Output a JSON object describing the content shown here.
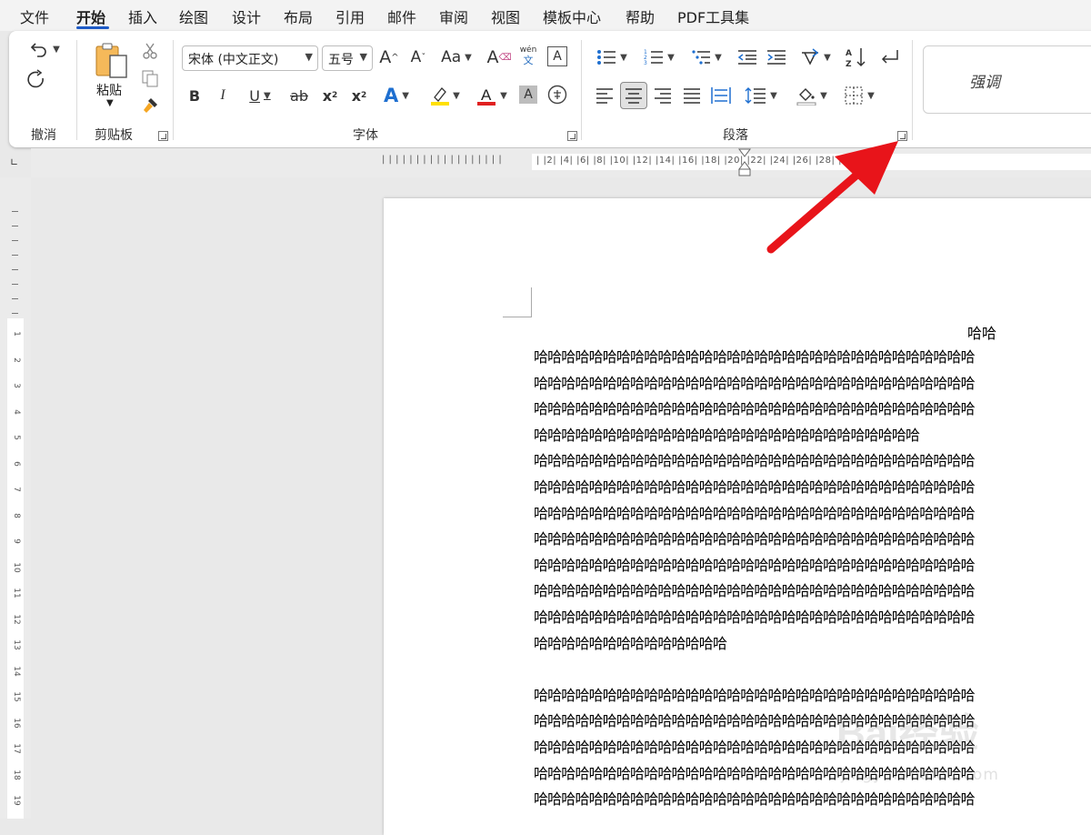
{
  "menu": {
    "items": [
      "文件",
      "开始",
      "插入",
      "绘图",
      "设计",
      "布局",
      "引用",
      "邮件",
      "审阅",
      "视图",
      "模板中心",
      "帮助",
      "PDF工具集"
    ],
    "active": "开始"
  },
  "ribbon": {
    "undo_group": {
      "label": "撤消",
      "undo_icon": "undo-icon",
      "redo_icon": "redo-icon"
    },
    "clipboard_group": {
      "label": "剪贴板",
      "paste_label": "粘贴"
    },
    "font_group": {
      "label": "字体",
      "font_name": "宋体 (中文正文)",
      "font_size": "五号",
      "change_case_label": "Aa",
      "phonetic_top": "wén",
      "phonetic_bottom": "文"
    },
    "paragraph_group": {
      "label": "段落"
    },
    "styles": {
      "preview": "强调"
    }
  },
  "ruler": {
    "h_left_ticks": "| | | | | | | | | | | | | | | | | |",
    "h_numbers": "|  |2|  |4|  |6|  |8|  |10|  |12|  |14|  |16|  |18|  |20|  |22|  |24|  |26|  |28|  |30|",
    "v_numbers": [
      "1",
      "2",
      "3",
      "4",
      "5",
      "6",
      "7",
      "8",
      "9",
      "10",
      "11",
      "12",
      "13",
      "14",
      "15",
      "16",
      "17",
      "18",
      "19"
    ],
    "tab_selector": "∟"
  },
  "document": {
    "title": "哈哈",
    "lines": [
      "哈哈哈哈哈哈哈哈哈哈哈哈哈哈哈哈哈哈哈哈哈哈哈哈哈哈哈哈哈哈哈哈",
      "哈哈哈哈哈哈哈哈哈哈哈哈哈哈哈哈哈哈哈哈哈哈哈哈哈哈哈哈哈哈哈哈",
      "哈哈哈哈哈哈哈哈哈哈哈哈哈哈哈哈哈哈哈哈哈哈哈哈哈哈哈哈哈哈哈哈",
      "哈哈哈哈哈哈哈哈哈哈哈哈哈哈哈哈哈哈哈哈哈哈哈哈哈哈哈哈",
      "哈哈哈哈哈哈哈哈哈哈哈哈哈哈哈哈哈哈哈哈哈哈哈哈哈哈哈哈哈哈哈哈",
      "哈哈哈哈哈哈哈哈哈哈哈哈哈哈哈哈哈哈哈哈哈哈哈哈哈哈哈哈哈哈哈哈",
      "哈哈哈哈哈哈哈哈哈哈哈哈哈哈哈哈哈哈哈哈哈哈哈哈哈哈哈哈哈哈哈哈",
      "哈哈哈哈哈哈哈哈哈哈哈哈哈哈哈哈哈哈哈哈哈哈哈哈哈哈哈哈哈哈哈哈",
      "哈哈哈哈哈哈哈哈哈哈哈哈哈哈哈哈哈哈哈哈哈哈哈哈哈哈哈哈哈哈哈哈",
      "哈哈哈哈哈哈哈哈哈哈哈哈哈哈哈哈哈哈哈哈哈哈哈哈哈哈哈哈哈哈哈哈",
      "哈哈哈哈哈哈哈哈哈哈哈哈哈哈哈哈哈哈哈哈哈哈哈哈哈哈哈哈哈哈哈哈",
      "哈哈哈哈哈哈哈哈哈哈哈哈哈哈",
      "",
      "哈哈哈哈哈哈哈哈哈哈哈哈哈哈哈哈哈哈哈哈哈哈哈哈哈哈哈哈哈哈哈哈",
      "哈哈哈哈哈哈哈哈哈哈哈哈哈哈哈哈哈哈哈哈哈哈哈哈哈哈哈哈哈哈哈哈",
      "哈哈哈哈哈哈哈哈哈哈哈哈哈哈哈哈哈哈哈哈哈哈哈哈哈哈哈哈哈哈哈哈",
      "哈哈哈哈哈哈哈哈哈哈哈哈哈哈哈哈哈哈哈哈哈哈哈哈哈哈哈哈哈哈哈哈",
      "哈哈哈哈哈哈哈哈哈哈哈哈哈哈哈哈哈哈哈哈哈哈哈哈哈哈哈哈哈哈哈哈"
    ]
  },
  "watermark": {
    "logo": "Bai经验",
    "url": "jingyan.baidu.com"
  },
  "colors": {
    "accent": "#1f5bc6",
    "arrow": "#e8141a",
    "highlight": "#ffe000",
    "font_color": "#e02020"
  }
}
